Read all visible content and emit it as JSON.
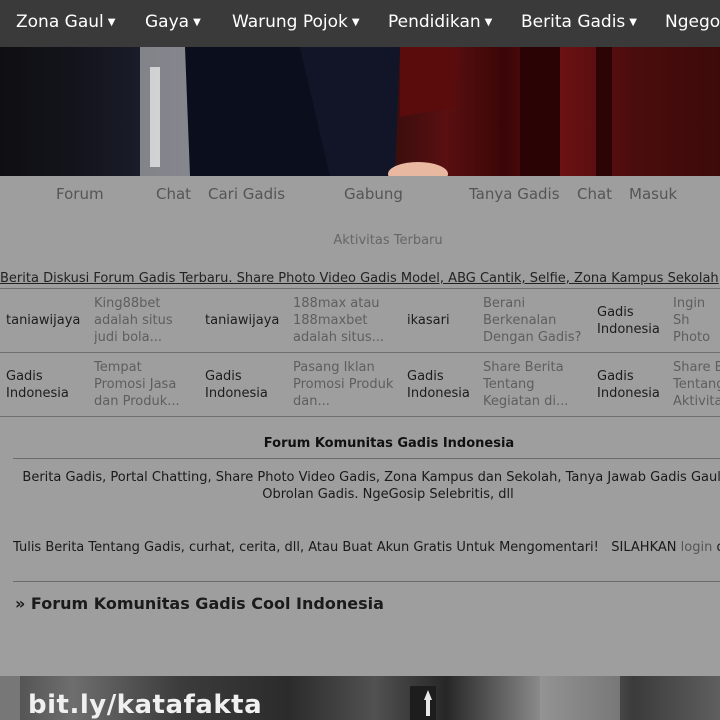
{
  "topnav": {
    "items": [
      {
        "label": "Zona Gaul"
      },
      {
        "label": "Gaya"
      },
      {
        "label": "Warung Pojok"
      },
      {
        "label": "Pendidikan"
      },
      {
        "label": "Berita Gadis"
      },
      {
        "label": "Ngegos"
      }
    ],
    "caret_icon": "caret-down-icon"
  },
  "secnav": {
    "forum": "Forum",
    "chat": "Chat",
    "cari_gadis": "Cari Gadis",
    "gabung": "Gabung",
    "tanya_gadis": "Tanya Gadis",
    "chat2": "Chat",
    "masuk": "Masuk"
  },
  "activity": {
    "label": "Aktivitas Terbaru"
  },
  "ticker": {
    "text": "Berita Diskusi Forum Gadis Terbaru. Share Photo Video Gadis Model, ABG Cantik, Selfie, Zona Kampus Sekolah"
  },
  "recent": {
    "rows": [
      {
        "cells": [
          {
            "user": "taniawijaya",
            "snippet": "King88bet adalah situs judi bola..."
          },
          {
            "user": "taniawijaya",
            "snippet": "188max atau 188maxbet adalah situs..."
          },
          {
            "user": "ikasari",
            "snippet": "Berani Berkenalan Dengan Gadis?"
          },
          {
            "user": "Gadis Indonesia",
            "snippet": "Ingin Sh Photo G Gadis C"
          }
        ]
      },
      {
        "cells": [
          {
            "user": "Gadis Indonesia",
            "snippet": "Tempat Promosi Jasa dan Produk..."
          },
          {
            "user": "Gadis Indonesia",
            "snippet": "Pasang Iklan Promosi Produk dan..."
          },
          {
            "user": "Gadis Indonesia",
            "snippet": "Share Berita Tentang Kegiatan di..."
          },
          {
            "user": "Gadis Indonesia",
            "snippet": "Share B Tentang Aktivita"
          }
        ]
      }
    ]
  },
  "forum": {
    "heading": "Forum Komunitas Gadis Indonesia",
    "description": "Berita Gadis, Portal Chatting, Share Photo Video Gadis, Zona Kampus dan Sekolah, Tanya Jawab Gadis Gaul. dan Obrolan Gadis. NgeGosip Selebritis, dll",
    "cta_text": "Tulis Berita Tentang Gadis, curhat, cerita, dll, Atau Buat Akun Gratis Untuk Mengomentari!",
    "cta_prefix": "SILAHKAN",
    "cta_login": "login",
    "cta_suffix": "d",
    "title_marker": "»",
    "title": "Forum Komunitas Gadis Cool Indonesia"
  },
  "bottom_photo": {
    "watermark": "bit.ly/katafakta"
  }
}
